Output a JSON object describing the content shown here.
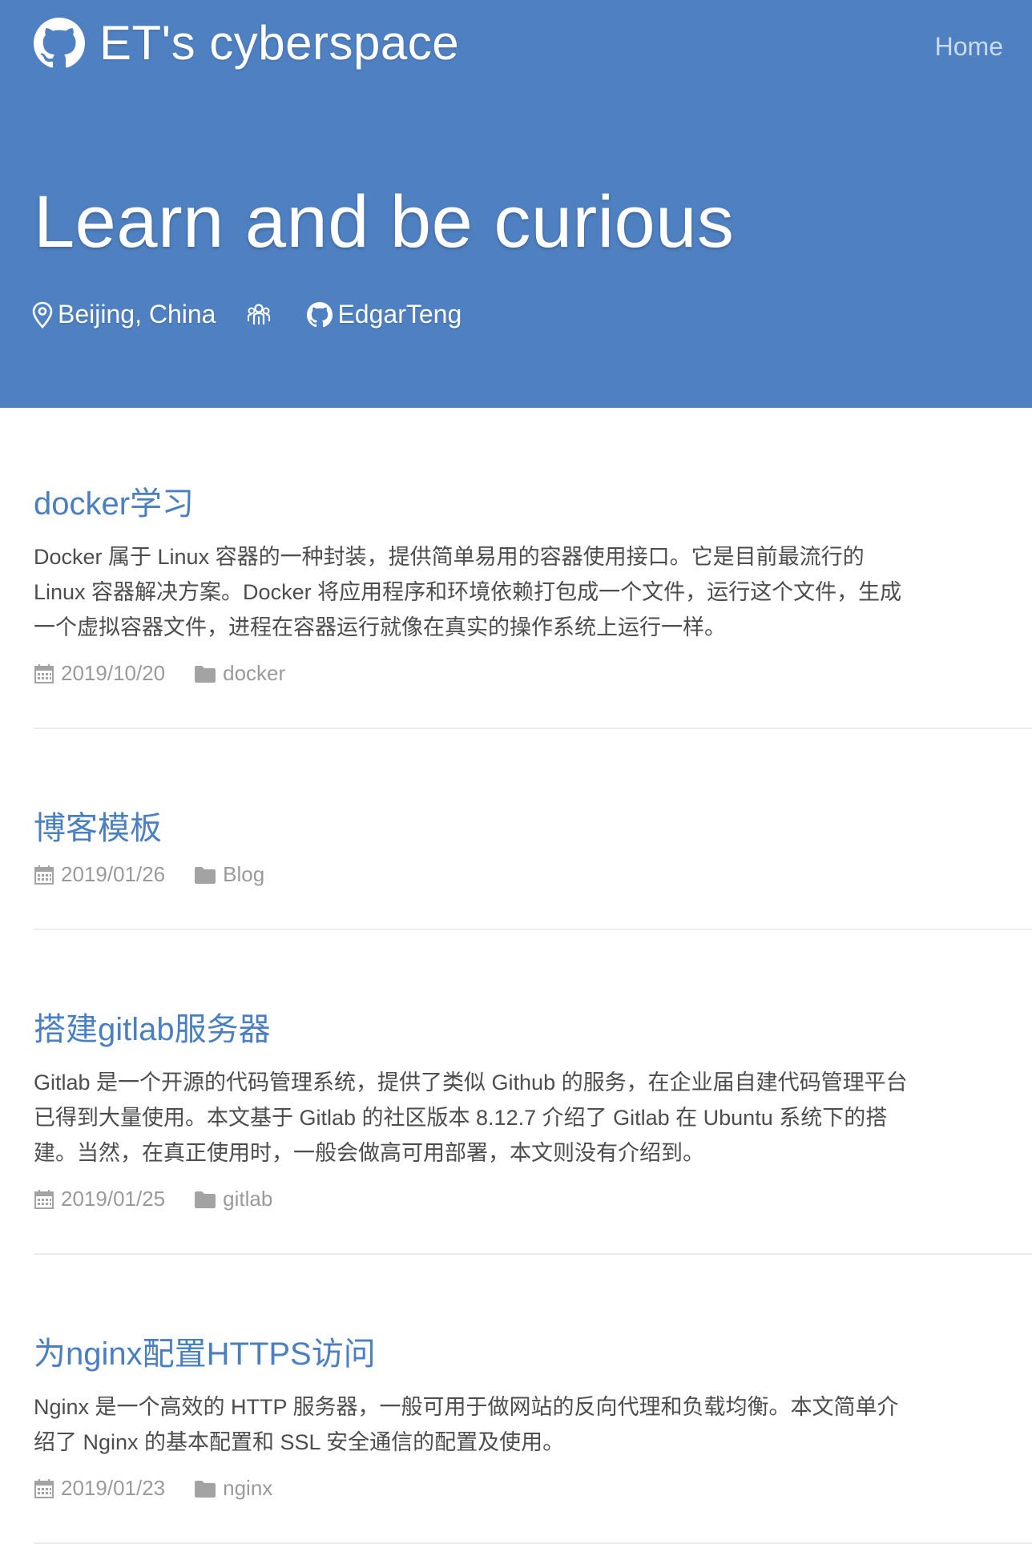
{
  "header": {
    "site_title": "ET's cyberspace",
    "nav": {
      "home": "Home"
    },
    "tagline": "Learn and be curious",
    "location": "Beijing, China",
    "github_user": "EdgarTeng"
  },
  "posts": [
    {
      "title": "docker学习",
      "excerpt": "Docker 属于 Linux 容器的一种封装，提供简单易用的容器使用接口。它是目前最流行的 Linux 容器解决方案。Docker 将应用程序和环境依赖打包成一个文件，运行这个文件，生成一个虚拟容器文件，进程在容器运行就像在真实的操作系统上运行一样。",
      "date": "2019/10/20",
      "category": "docker"
    },
    {
      "title": "博客模板",
      "excerpt": "",
      "date": "2019/01/26",
      "category": "Blog"
    },
    {
      "title": "搭建gitlab服务器",
      "excerpt": "Gitlab 是一个开源的代码管理系统，提供了类似 Github 的服务，在企业届自建代码管理平台已得到大量使用。本文基于 Gitlab 的社区版本 8.12.7 介绍了 Gitlab 在 Ubuntu 系统下的搭建。当然，在真正使用时，一般会做高可用部署，本文则没有介绍到。",
      "date": "2019/01/25",
      "category": "gitlab"
    },
    {
      "title": "为nginx配置HTTPS访问",
      "excerpt": "Nginx 是一个高效的 HTTP 服务器，一般可用于做网站的反向代理和负载均衡。本文简单介绍了 Nginx 的基本配置和 SSL 安全通信的配置及使用。",
      "date": "2019/01/23",
      "category": "nginx"
    }
  ],
  "colors": {
    "hero_bg": "#4f81c2",
    "link": "#4a7fc1",
    "meta": "#9a9a9a",
    "text": "#4d4d4d"
  },
  "icons": [
    "github-icon",
    "map-marker-icon",
    "team-icon",
    "calendar-icon",
    "folder-icon"
  ]
}
